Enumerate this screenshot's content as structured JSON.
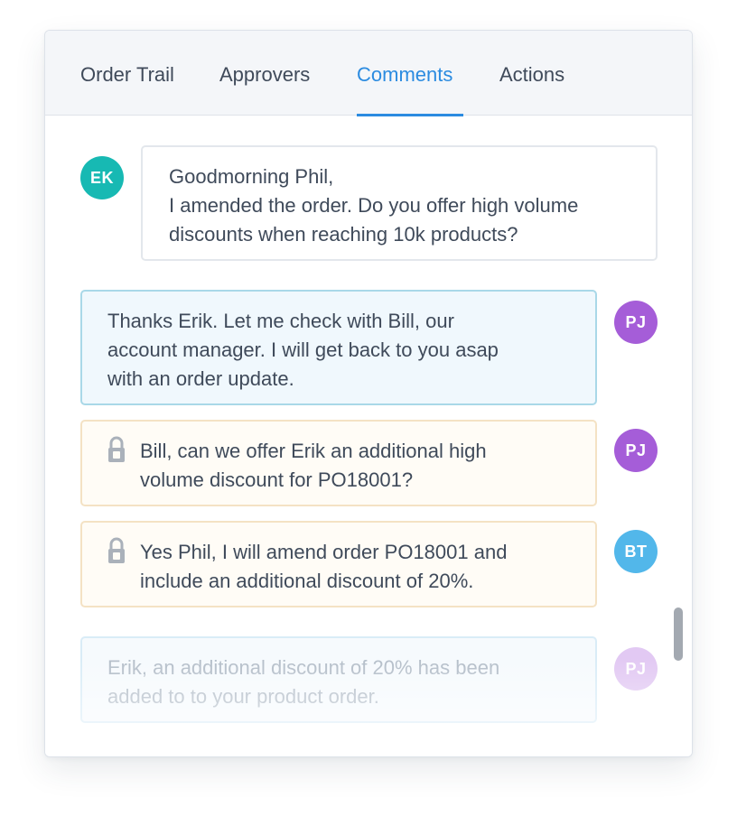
{
  "tabs": [
    {
      "label": "Order Trail"
    },
    {
      "label": "Approvers"
    },
    {
      "label": "Comments"
    },
    {
      "label": "Actions"
    }
  ],
  "active_tab": "Comments",
  "colors": {
    "accent": "#2b8be0",
    "avatar_ek": "#17b9b3",
    "avatar_pj": "#a55dd8",
    "avatar_bt": "#52b7ea"
  },
  "comments": [
    {
      "avatar": "EK",
      "lines": [
        "Goodmorning Phil,",
        "I amended the order. Do you offer high volume",
        "discounts when reaching 10k products?"
      ]
    },
    {
      "avatar": "PJ",
      "lines": [
        "Thanks Erik. Let me check with Bill, our",
        "account manager. I will get back to you asap",
        "with an order update."
      ]
    },
    {
      "avatar": "PJ",
      "private": true,
      "icon": "lock-icon",
      "lines": [
        "Bill, can we offer Erik an additional high",
        "volume discount for PO18001?"
      ]
    },
    {
      "avatar": "BT",
      "private": true,
      "icon": "lock-icon",
      "lines": [
        "Yes Phil, I will amend order PO18001 and",
        "include an additional discount of 20%."
      ]
    },
    {
      "avatar": "PJ",
      "lines": [
        "Erik, an additional discount of 20% has been",
        "added to to your product order."
      ]
    }
  ]
}
